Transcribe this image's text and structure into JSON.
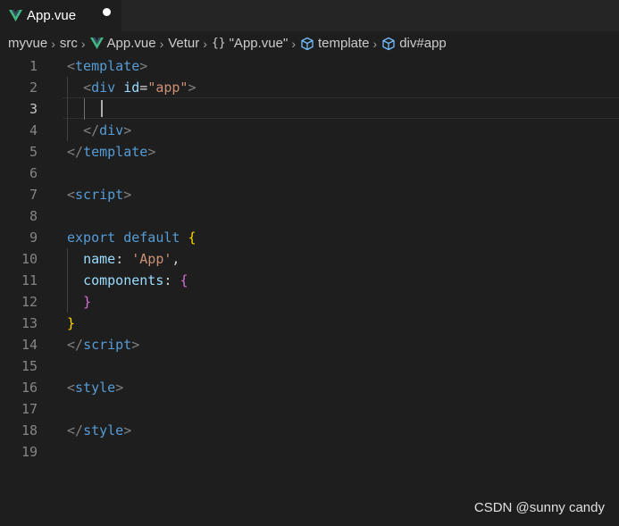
{
  "tab": {
    "label": "App.vue",
    "dirty": true
  },
  "breadcrumb": {
    "items": [
      "myvue",
      "src",
      "App.vue",
      "Vetur",
      "\"App.vue\"",
      "template",
      "div#app"
    ]
  },
  "editor": {
    "line_numbers": [
      "1",
      "2",
      "3",
      "4",
      "5",
      "6",
      "7",
      "8",
      "9",
      "10",
      "11",
      "12",
      "13",
      "14",
      "15",
      "16",
      "17",
      "18",
      "19"
    ],
    "active_line": "3",
    "lines": [
      [
        [
          "<",
          "t-punc"
        ],
        [
          "template",
          "t-tag"
        ],
        [
          ">",
          "t-punc"
        ]
      ],
      [
        [
          "  ",
          "t-plain"
        ],
        [
          "<",
          "t-punc"
        ],
        [
          "div",
          "t-tag"
        ],
        [
          " ",
          "t-plain"
        ],
        [
          "id",
          "t-attr"
        ],
        [
          "=",
          "t-eq"
        ],
        [
          "\"app\"",
          "t-str"
        ],
        [
          ">",
          "t-punc"
        ]
      ],
      [],
      [
        [
          "  ",
          "t-plain"
        ],
        [
          "</",
          "t-punc"
        ],
        [
          "div",
          "t-tag"
        ],
        [
          ">",
          "t-punc"
        ]
      ],
      [
        [
          "</",
          "t-punc"
        ],
        [
          "template",
          "t-tag"
        ],
        [
          ">",
          "t-punc"
        ]
      ],
      [],
      [
        [
          "<",
          "t-punc"
        ],
        [
          "script",
          "t-tag"
        ],
        [
          ">",
          "t-punc"
        ]
      ],
      [],
      [
        [
          "export",
          "t-kw"
        ],
        [
          " ",
          "t-plain"
        ],
        [
          "default",
          "t-kw"
        ],
        [
          " ",
          "t-plain"
        ],
        [
          "{",
          "t-brace1"
        ]
      ],
      [
        [
          "  ",
          "t-plain"
        ],
        [
          "name",
          "t-prop"
        ],
        [
          ": ",
          "t-plain"
        ],
        [
          "'App'",
          "t-str"
        ],
        [
          ",",
          "t-plain"
        ]
      ],
      [
        [
          "  ",
          "t-plain"
        ],
        [
          "components",
          "t-prop"
        ],
        [
          ": ",
          "t-plain"
        ],
        [
          "{",
          "t-brace2"
        ]
      ],
      [
        [
          "  ",
          "t-plain"
        ],
        [
          "}",
          "t-brace2"
        ]
      ],
      [
        [
          "}",
          "t-brace1"
        ]
      ],
      [
        [
          "</",
          "t-punc"
        ],
        [
          "script",
          "t-tag"
        ],
        [
          ">",
          "t-punc"
        ]
      ],
      [],
      [
        [
          "<",
          "t-punc"
        ],
        [
          "style",
          "t-tag"
        ],
        [
          ">",
          "t-punc"
        ]
      ],
      [],
      [
        [
          "</",
          "t-punc"
        ],
        [
          "style",
          "t-tag"
        ],
        [
          ">",
          "t-punc"
        ]
      ],
      []
    ]
  },
  "watermark": "CSDN @sunny candy",
  "colors": {
    "background": "#1e1e1e",
    "tag": "#569cd6",
    "string": "#ce9178",
    "attribute": "#9cdcfe",
    "bracket_gold": "#ffd700",
    "bracket_purple": "#da70d6",
    "vue_green": "#41b883"
  }
}
